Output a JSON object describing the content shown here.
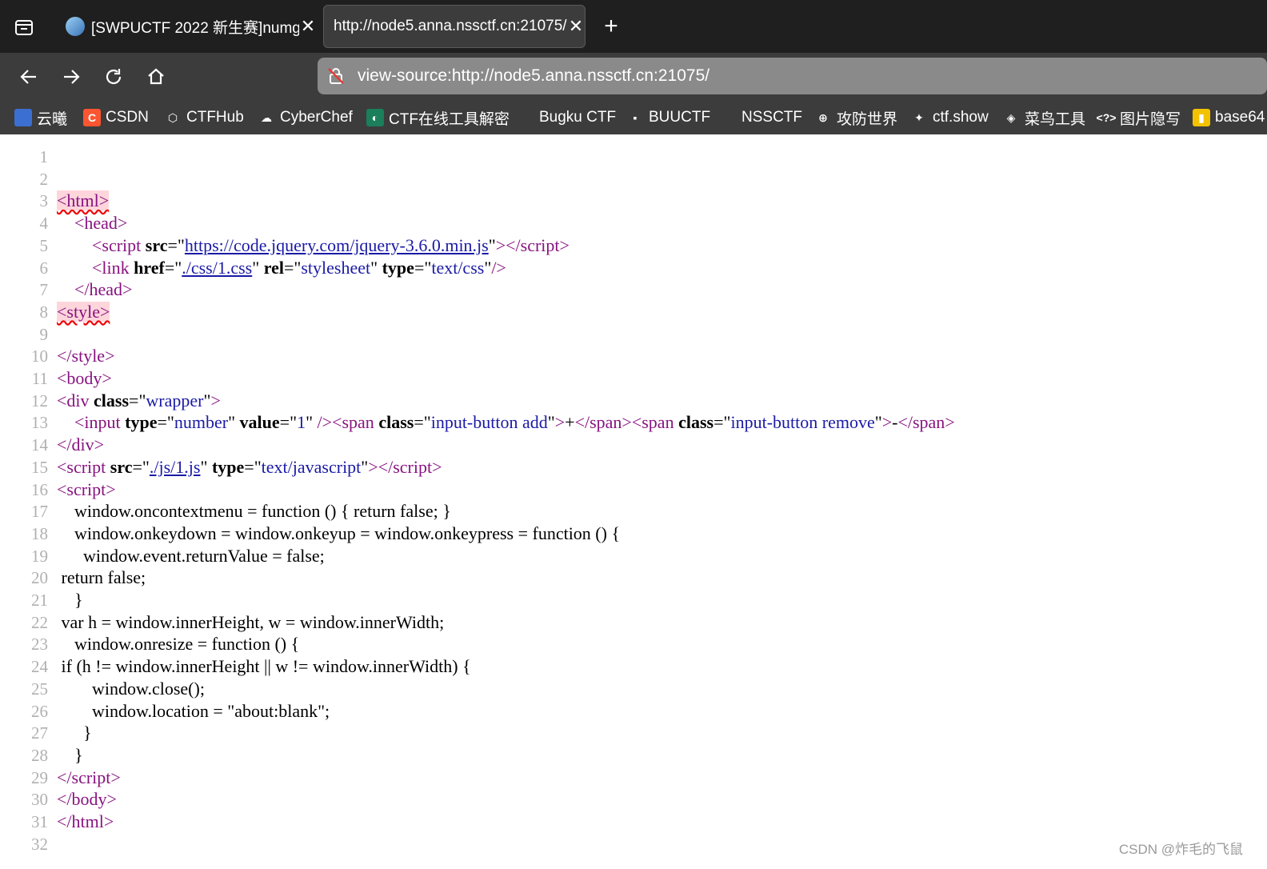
{
  "tabs": [
    {
      "title": "[SWPUCTF 2022 新生赛]numgame"
    },
    {
      "title": "http://node5.anna.nssctf.cn:21075/"
    }
  ],
  "address_bar": {
    "url": "view-source:http://node5.anna.nssctf.cn:21075/"
  },
  "bookmarks": [
    {
      "label": "云曦",
      "icon": "yunxi-icon",
      "color": "#3b6fd1"
    },
    {
      "label": "CSDN",
      "icon": "csdn-icon",
      "color": "#fc5531",
      "glyph": "C"
    },
    {
      "label": "CTFHub",
      "icon": "ctfhub-icon",
      "color": "#3c3c3c",
      "glyph": "⬡"
    },
    {
      "label": "CyberChef",
      "icon": "cyberchef-icon",
      "color": "#3c3c3c",
      "glyph": "☁"
    },
    {
      "label": "CTF在线工具解密",
      "icon": "ctf-tools-icon",
      "color": "#1a7f5a",
      "glyph": "◐"
    },
    {
      "label": "Bugku CTF",
      "icon": "bugku-icon",
      "color": "#3c3c3c",
      "glyph": ""
    },
    {
      "label": "BUUCTF",
      "icon": "buuctf-icon",
      "color": "#3c3c3c",
      "glyph": "▪"
    },
    {
      "label": "NSSCTF",
      "icon": "nssctf-icon",
      "color": "#3c3c3c",
      "glyph": ""
    },
    {
      "label": "攻防世界",
      "icon": "globe-icon",
      "color": "#3c3c3c",
      "glyph": "⊕"
    },
    {
      "label": "ctf.show",
      "icon": "ctfshow-icon",
      "color": "#3c3c3c",
      "glyph": "✦"
    },
    {
      "label": "菜鸟工具",
      "icon": "runoob-icon",
      "color": "#3c3c3c",
      "glyph": "◈"
    },
    {
      "label": "图片隐写",
      "icon": "code-icon",
      "color": "#3c3c3c",
      "glyph": "<?>"
    },
    {
      "label": "base64",
      "icon": "base64-icon",
      "color": "#f2c200",
      "glyph": "▮"
    }
  ],
  "source_lines": [
    {
      "n": "1",
      "html": ""
    },
    {
      "n": "2",
      "html": ""
    },
    {
      "n": "3",
      "html": "<span class='tag err'>&lt;html&gt;</span>"
    },
    {
      "n": "4",
      "html": "    <span class='tag'>&lt;head&gt;</span>"
    },
    {
      "n": "5",
      "html": "        <span class='tag'>&lt;script</span> <span class='an'>src</span>=\"<a class='lk'>https://code.jquery.com/jquery-3.6.0.min.js</a>\"<span class='tag'>&gt;&lt;/script&gt;</span>"
    },
    {
      "n": "6",
      "html": "        <span class='tag'>&lt;link</span> <span class='an'>href</span>=\"<a class='lk'>./css/1.css</a>\" <span class='an'>rel</span>=\"<span class='av'>stylesheet</span>\" <span class='an'>type</span>=\"<span class='av'>text/css</span>\"<span class='tag'>/&gt;</span>"
    },
    {
      "n": "7",
      "html": "    <span class='tag'>&lt;/head&gt;</span>"
    },
    {
      "n": "8",
      "html": "<span class='tag err'>&lt;style&gt;</span>"
    },
    {
      "n": "9",
      "html": ""
    },
    {
      "n": "10",
      "html": "<span class='tag'>&lt;/style&gt;</span>"
    },
    {
      "n": "11",
      "html": "<span class='tag'>&lt;body&gt;</span>"
    },
    {
      "n": "12",
      "html": "<span class='tag'>&lt;div</span> <span class='an'>class</span>=\"<span class='av'>wrapper</span>\"<span class='tag'>&gt;</span>"
    },
    {
      "n": "13",
      "html": "    <span class='tag'>&lt;input</span> <span class='an'>type</span>=\"<span class='av'>number</span>\" <span class='an'>value</span>=\"<span class='av'>1</span>\" <span class='tag'>/&gt;&lt;span</span> <span class='an'>class</span>=\"<span class='av'>input-button add</span>\"<span class='tag'>&gt;</span>+<span class='tag'>&lt;/span&gt;&lt;span</span> <span class='an'>class</span>=\"<span class='av'>input-button remove</span>\"<span class='tag'>&gt;</span>-<span class='tag'>&lt;/span&gt;</span>"
    },
    {
      "n": "14",
      "html": "<span class='tag'>&lt;/div&gt;</span>"
    },
    {
      "n": "15",
      "html": "<span class='tag'>&lt;script</span> <span class='an'>src</span>=\"<a class='lk'>./js/1.js</a>\" <span class='an'>type</span>=\"<span class='av'>text/javascript</span>\"<span class='tag'>&gt;&lt;/script&gt;</span>"
    },
    {
      "n": "16",
      "html": "<span class='tag'>&lt;script&gt;</span>"
    },
    {
      "n": "17",
      "html": "    window.oncontextmenu = function () { return false; }"
    },
    {
      "n": "18",
      "html": "    window.onkeydown = window.onkeyup = window.onkeypress = function () {"
    },
    {
      "n": "19",
      "html": "      window.event.returnValue = false;"
    },
    {
      "n": "20",
      "html": " return false;"
    },
    {
      "n": "21",
      "html": "    }"
    },
    {
      "n": "22",
      "html": " var h = window.innerHeight, w = window.innerWidth;"
    },
    {
      "n": "23",
      "html": "    window.onresize = function () {"
    },
    {
      "n": "24",
      "html": " if (h != window.innerHeight || w != window.innerWidth) {"
    },
    {
      "n": "25",
      "html": "        window.close();"
    },
    {
      "n": "26",
      "html": "        window.location = \"about:blank\";"
    },
    {
      "n": "27",
      "html": "      }"
    },
    {
      "n": "28",
      "html": "    }"
    },
    {
      "n": "29",
      "html": "<span class='tag'>&lt;/script&gt;</span>"
    },
    {
      "n": "30",
      "html": "<span class='tag'>&lt;/body&gt;</span>"
    },
    {
      "n": "31",
      "html": "<span class='tag'>&lt;/html&gt;</span>"
    },
    {
      "n": "32",
      "html": ""
    }
  ],
  "watermark": "CSDN @炸毛的飞鼠"
}
